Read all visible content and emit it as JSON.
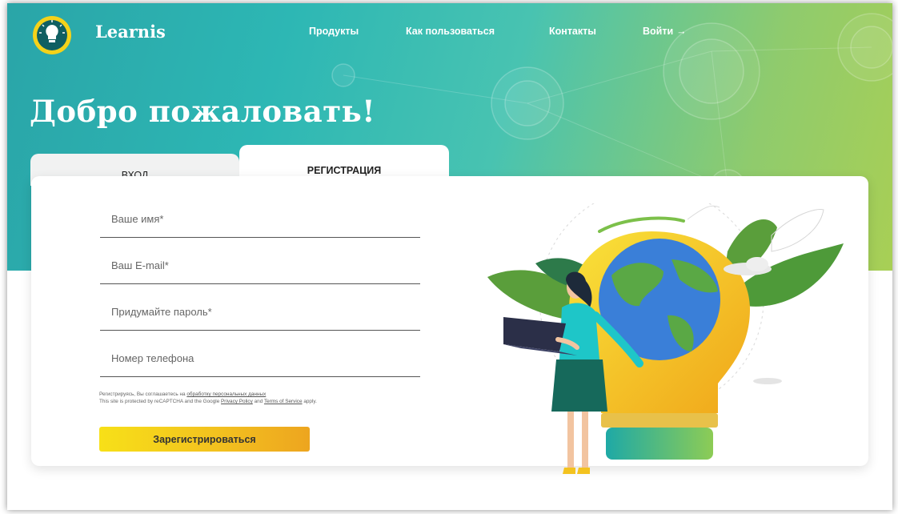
{
  "header": {
    "brand": "Learnis",
    "nav": [
      {
        "label": "Продукты"
      },
      {
        "label": "Как пользоваться"
      },
      {
        "label": "Контакты"
      },
      {
        "label": "Войти",
        "arrow": "→"
      }
    ]
  },
  "hero": {
    "title": "Добро пожаловать!"
  },
  "tabs": {
    "login": "вход",
    "register": "регистрация"
  },
  "form": {
    "name_placeholder": "Ваше имя*",
    "email_placeholder": "Ваш E-mail*",
    "password_placeholder": "Придумайте пароль*",
    "phone_placeholder": "Номер телефона",
    "consent_prefix": "Регистрируясь, Вы соглашаетесь на",
    "consent_link": "обработку персональных данных",
    "recaptcha_prefix": "This site is protected by reCAPTCHA and the Google",
    "privacy_link": "Privacy Policy",
    "and_text": "and",
    "terms_link": "Terms of Service",
    "apply_text": "apply.",
    "submit_label": "Зарегистрироваться"
  },
  "colors": {
    "hero_start": "#2aa5a8",
    "hero_end": "#a8cf55",
    "button_start": "#f7e018",
    "button_end": "#eda51f"
  },
  "icons": {
    "logo": "lightbulb-logo-icon",
    "login_arrow": "arrow-right-icon",
    "illustration": "woman-laptop-lightbulb-globe-illustration"
  }
}
